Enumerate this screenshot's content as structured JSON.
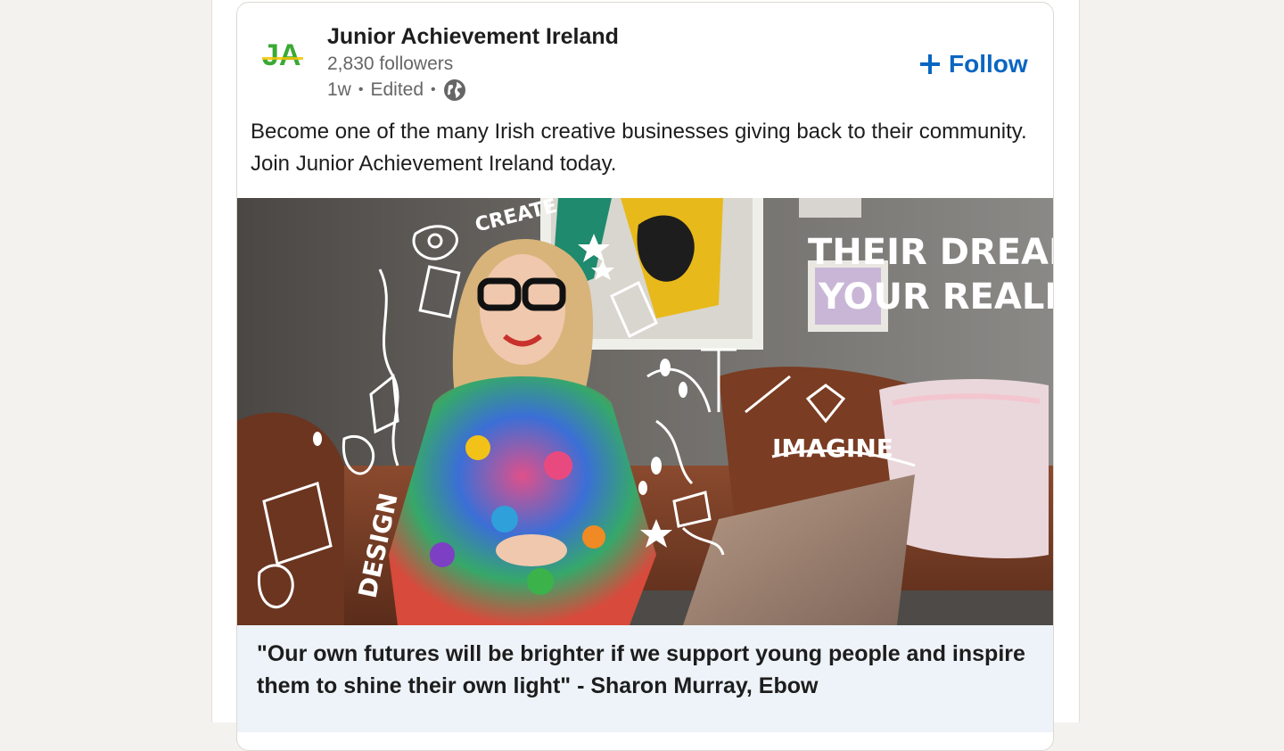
{
  "post": {
    "author": {
      "name": "Junior Achievement Ireland",
      "logo_text": "JA",
      "followers": "2,830 followers",
      "time": "1w",
      "edited": "Edited",
      "visibility_icon": "globe-icon"
    },
    "follow_label": "Follow",
    "follow_icon": "plus-icon",
    "text": "Become one of the many Irish creative businesses giving back to their community. Join Junior Achievement Ireland today.",
    "image": {
      "overlay_line1": "THEIR DREAMS.",
      "overlay_line2": "YOUR REALITY.",
      "doodle_create": "CREATE",
      "doodle_imagine": "IMAGINE",
      "doodle_design": "DESIGN"
    },
    "link_preview": {
      "title": "\"Our own futures will be brighter if we support young people and inspire them to shine their own light\" - Sharon Murray, Ebow"
    }
  },
  "colors": {
    "accent": "#0a66c2",
    "page_bg": "#f4f2ee",
    "preview_bg": "#edf3f8",
    "logo_green": "#3aa935",
    "logo_yellow": "#f5c400"
  }
}
